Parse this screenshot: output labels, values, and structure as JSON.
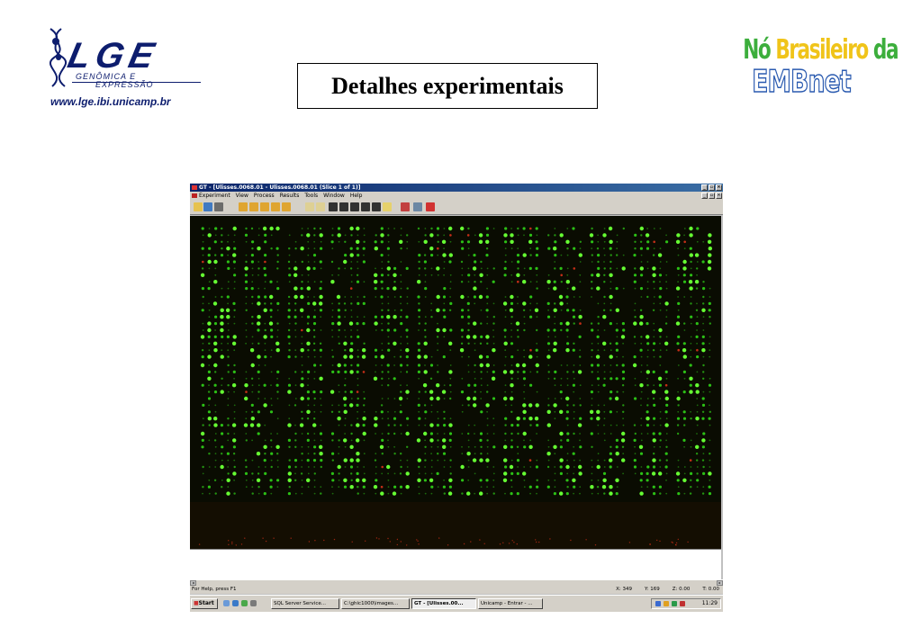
{
  "header": {
    "lge_logo": {
      "letters": "LGE",
      "line1": "GENÔMICA E",
      "line2": "EXPRESSÃO",
      "url": "www.lge.ibi.unicamp.br"
    },
    "slide_title": "Detalhes experimentais",
    "embnet_logo": {
      "line1_part1": "Nó",
      "line1_part2": "Brasileiro",
      "line1_part3": "da",
      "line2": "EMBnet"
    }
  },
  "app_window": {
    "title": "GT - [Ulisses.0068.01 - Ulisses.0068.01 (Slice 1 of 1)]",
    "menu": [
      "Experiment",
      "View",
      "Process",
      "Results",
      "Tools",
      "Window",
      "Help"
    ],
    "toolbar_icons": [
      "open-icon",
      "save-icon",
      "print-icon",
      "arrow-up-icon",
      "arrow-down-icon",
      "sort-up-icon",
      "sort-down-icon",
      "sort-both-icon",
      "grid-select-icon",
      "grid-select-2-icon",
      "pointer-icon",
      "pointer-grid-icon",
      "pointer-spot-icon",
      "help-pointer-icon",
      "help-pointer-2-icon",
      "help-pointer-3-icon",
      "export-icon",
      "copy-icon",
      "record-icon"
    ],
    "status": {
      "help_text": "For Help, press F1",
      "x_label": "X:",
      "x_value": "349",
      "y_label": "Y:",
      "y_value": "169",
      "z_label": "Z:",
      "z_value": "0.00",
      "t_label": "T:",
      "t_value": "0.00"
    },
    "microarray": {
      "background": "#0a0c02",
      "spot_color": "#33e01a",
      "bright_spot_color": "#66ff33",
      "red_spot_color": "#d8321a"
    }
  },
  "taskbar": {
    "start_label": "Start",
    "tasks": [
      {
        "label": "SQL Server Service...",
        "active": false
      },
      {
        "label": "C:\\ghic1000\\images...",
        "active": false
      },
      {
        "label": "GT - [Ulisses.00...",
        "active": true
      },
      {
        "label": "Unicamp - Entrar - ...",
        "active": false
      }
    ],
    "clock": "11:29"
  }
}
